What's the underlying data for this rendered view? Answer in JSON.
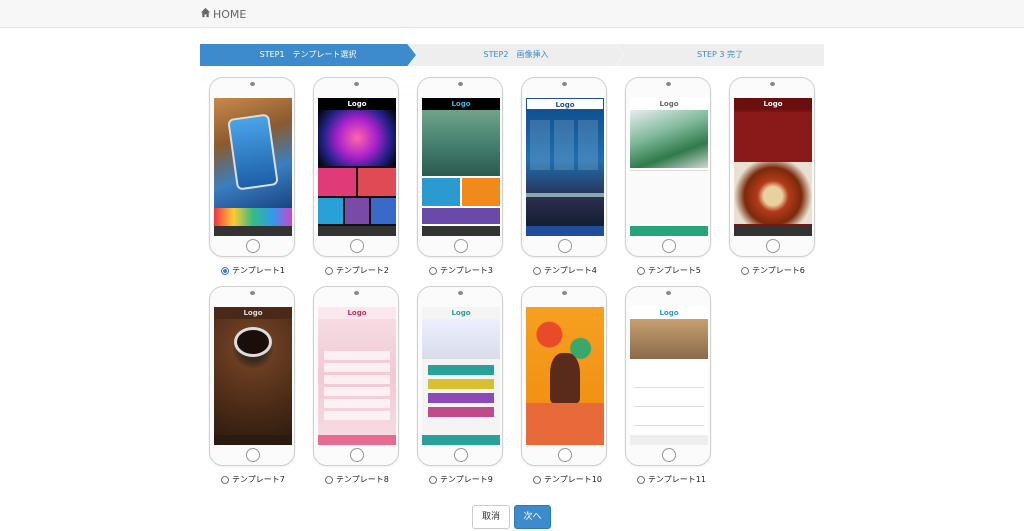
{
  "header": {
    "home_label": "HOME"
  },
  "steps": [
    {
      "label": "STEP1　テンプレート選択"
    },
    {
      "label": "STEP2　画像挿入"
    },
    {
      "label": "STEP 3 完了"
    }
  ],
  "screen_logo_text": "Logo",
  "templates": [
    {
      "label": "テンプレート1",
      "selected": true
    },
    {
      "label": "テンプレート2",
      "selected": false
    },
    {
      "label": "テンプレート3",
      "selected": false
    },
    {
      "label": "テンプレート4",
      "selected": false
    },
    {
      "label": "テンプレート5",
      "selected": false
    },
    {
      "label": "テンプレート6",
      "selected": false
    },
    {
      "label": "テンプレート7",
      "selected": false
    },
    {
      "label": "テンプレート8",
      "selected": false
    },
    {
      "label": "テンプレート9",
      "selected": false
    },
    {
      "label": "テンプレート10",
      "selected": false
    },
    {
      "label": "テンプレート11",
      "selected": false
    }
  ],
  "buttons": {
    "cancel": "取消",
    "next": "次へ"
  },
  "colors": {
    "accent": "#3d8bcd",
    "step_inactive": "#eeeeee"
  }
}
